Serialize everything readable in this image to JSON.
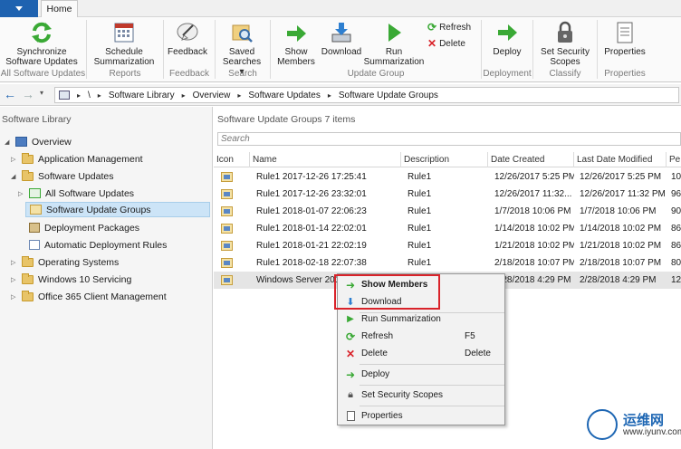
{
  "ribbon": {
    "home_tab": "Home",
    "buttons": [
      {
        "label": "Synchronize\nSoftware Updates",
        "icon": "sync-icon"
      },
      {
        "label": "Schedule\nSummarization",
        "icon": "calendar-icon"
      },
      {
        "label": "Feedback",
        "icon": "feedback-icon"
      },
      {
        "label": "Saved\nSearches ▾",
        "icon": "saved-searches-icon"
      },
      {
        "label": "Show\nMembers",
        "icon": "show-members-icon"
      },
      {
        "label": "Download",
        "icon": "download-icon"
      },
      {
        "label": "Run\nSummarization",
        "icon": "run-icon"
      },
      {
        "label": "Deploy",
        "icon": "deploy-icon"
      },
      {
        "label": "Set Security\nScopes",
        "icon": "lock-icon"
      },
      {
        "label": "Properties",
        "icon": "properties-icon"
      }
    ],
    "small_buttons": {
      "refresh": "Refresh",
      "delete": "Delete"
    },
    "groups": [
      "All Software Updates",
      "Reports",
      "Feedback",
      "Search",
      "Update Group",
      "Deployment",
      "Classify",
      "Properties"
    ]
  },
  "address": {
    "root": "\\",
    "crumbs": [
      "Software Library",
      "Overview",
      "Software Updates",
      "Software Update Groups"
    ]
  },
  "nav": {
    "header": "Software Library",
    "items": [
      {
        "label": "Overview"
      },
      {
        "label": "Application Management"
      },
      {
        "label": "Software Updates"
      },
      {
        "label": "All Software Updates"
      },
      {
        "label": "Software Update Groups"
      },
      {
        "label": "Deployment Packages"
      },
      {
        "label": "Automatic Deployment Rules"
      },
      {
        "label": "Operating Systems"
      },
      {
        "label": "Windows 10 Servicing"
      },
      {
        "label": "Office 365 Client Management"
      }
    ]
  },
  "main": {
    "header": "Software Update Groups 7 items",
    "search_placeholder": "Search",
    "columns": [
      "Icon",
      "Name",
      "Description",
      "Date Created",
      "Last Date Modified",
      "Pe"
    ],
    "rows": [
      {
        "name": "Rule1 2017-12-26 17:25:41",
        "desc": "Rule1",
        "created": "12/26/2017 5:25 PM",
        "modified": "12/26/2017 5:25 PM",
        "pe": "10"
      },
      {
        "name": "Rule1 2017-12-26 23:32:01",
        "desc": "Rule1",
        "created": "12/26/2017 11:32...",
        "modified": "12/26/2017 11:32 PM",
        "pe": "96"
      },
      {
        "name": "Rule1 2018-01-07 22:06:23",
        "desc": "Rule1",
        "created": "1/7/2018 10:06 PM",
        "modified": "1/7/2018 10:06 PM",
        "pe": "90"
      },
      {
        "name": "Rule1 2018-01-14 22:02:01",
        "desc": "Rule1",
        "created": "1/14/2018 10:02 PM",
        "modified": "1/14/2018 10:02 PM",
        "pe": "86"
      },
      {
        "name": "Rule1 2018-01-21 22:02:19",
        "desc": "Rule1",
        "created": "1/21/2018 10:02 PM",
        "modified": "1/21/2018 10:02 PM",
        "pe": "86"
      },
      {
        "name": "Rule1 2018-02-18 22:07:38",
        "desc": "Rule1",
        "created": "2/18/2018 10:07 PM",
        "modified": "2/18/2018 10:07 PM",
        "pe": "80"
      },
      {
        "name": "Windows Server 2016 Patch",
        "desc": "",
        "created": "2/28/2018 4:29 PM",
        "modified": "2/28/2018 4:29 PM",
        "pe": "12"
      }
    ]
  },
  "context_menu": {
    "show_members": "Show Members",
    "download": "Download",
    "run_summarization": "Run Summarization",
    "refresh": "Refresh",
    "refresh_shortcut": "F5",
    "delete": "Delete",
    "delete_shortcut": "Delete",
    "deploy": "Deploy",
    "set_security_scopes": "Set Security Scopes",
    "properties": "Properties"
  },
  "watermark": {
    "brand": "运维网",
    "url": "www.iyunv.com"
  },
  "colors": {
    "accent": "#1e62b0",
    "green": "#3aa935",
    "highlight": "#d9232a"
  }
}
